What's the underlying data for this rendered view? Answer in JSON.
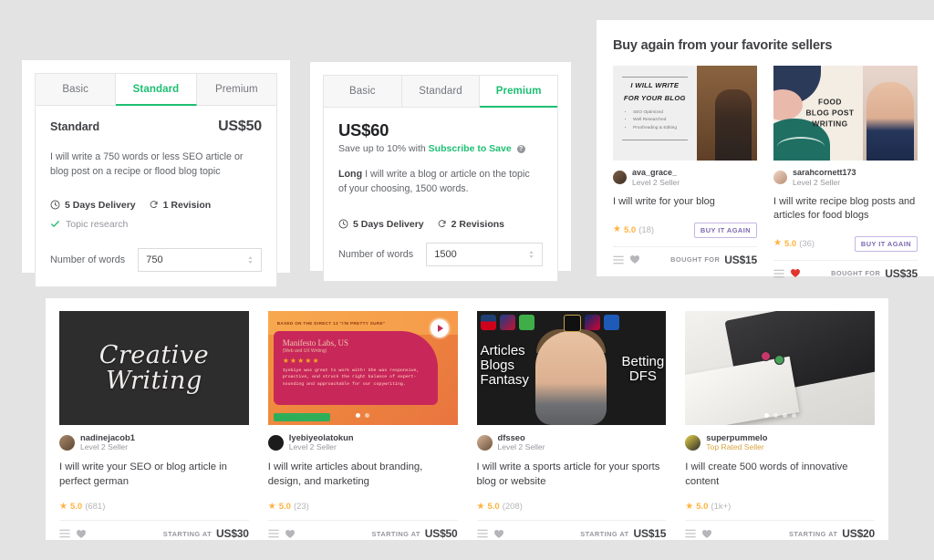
{
  "theme": {
    "page_bg": "#e3e3e3",
    "accent_green": "#1dbf73",
    "star_gold": "#ffb33e",
    "buy_again_purple": "#7b68b0",
    "text_dark": "#404145",
    "text_muted": "#95979d"
  },
  "pricing_standard": {
    "tabs": [
      {
        "label": "Basic",
        "active": false
      },
      {
        "label": "Standard",
        "active": true
      },
      {
        "label": "Premium",
        "active": false
      }
    ],
    "package_name": "Standard",
    "price": "US$50",
    "description": "I will write a 750 words or less SEO article or blog post on a recipe or flood blog topic",
    "delivery": "5 Days Delivery",
    "revisions": "1 Revision",
    "feature": "Topic research",
    "quantity_label": "Number of words",
    "quantity_value": "750"
  },
  "pricing_premium": {
    "tabs": [
      {
        "label": "Basic",
        "active": false
      },
      {
        "label": "Standard",
        "active": false
      },
      {
        "label": "Premium",
        "active": true
      }
    ],
    "price": "US$60",
    "save_prefix": "Save up to 10% with",
    "save_link": "Subscribe to Save",
    "info_glyph": "?",
    "description_bold": "Long",
    "description": " I will write a blog or article on the topic of your choosing, 1500 words.",
    "delivery": "5 Days Delivery",
    "revisions": "2 Revisions",
    "quantity_label": "Number of words",
    "quantity_value": "1500"
  },
  "buy_again": {
    "title": "Buy again from your favorite sellers",
    "cards": [
      {
        "art": "blog",
        "art_text": {
          "line1": "I WILL WRITE",
          "line2": "FOR YOUR BLOG",
          "bullets": [
            "SEO Optimized",
            "Well Researched",
            "Proofreading & Editing"
          ]
        },
        "seller": "ava_grace_",
        "level": "Level 2 Seller",
        "title": "I will write for your blog",
        "rating": "5.0",
        "reviews": "(18)",
        "button": "BUY IT AGAIN",
        "foot_label": "BOUGHT FOR",
        "price": "US$15",
        "favorited": false
      },
      {
        "art": "food",
        "art_text": {
          "line1": "FOOD",
          "line2": "BLOG POST",
          "line3": "WRITING"
        },
        "seller": "sarahcornett173",
        "level": "Level 2 Seller",
        "title": "I will write recipe blog posts and articles for food blogs",
        "rating": "5.0",
        "reviews": "(36)",
        "button": "BUY IT AGAIN",
        "foot_label": "BOUGHT FOR",
        "price": "US$35",
        "favorited": true
      }
    ]
  },
  "gig_row": {
    "cards": [
      {
        "art": "creative",
        "art_text": {
          "line1": "Creative",
          "line2": "Writing"
        },
        "seller": "nadinejacob1",
        "level": "Level 2 Seller",
        "level_style": "normal",
        "title": "I will write your SEO or blog article in perfect german",
        "rating": "5.0",
        "reviews": "(681)",
        "foot_label": "STARTING AT",
        "price": "US$30",
        "dots": 0,
        "active_dot": 0,
        "has_play": false
      },
      {
        "art": "video",
        "art_text": {
          "banner": "BASED ON THE DIRECT 13 \"I'M PRETTY SURE\"",
          "client": "Manifesto Labs, US",
          "client_sub": "(Web and UX Writing)",
          "stars": "★★★★★",
          "review": "Iyebiye was great to work with! She was responsive, proactive, and struck the right balance of expert-sounding and approachable for our copywriting."
        },
        "seller": "Iyebiyeolatokun",
        "level": "Level 2 Seller",
        "level_style": "normal",
        "title": "I will write articles about branding, design, and marketing",
        "rating": "5.0",
        "reviews": "(23)",
        "foot_label": "STARTING AT",
        "price": "US$50",
        "dots": 2,
        "active_dot": 0,
        "has_play": true
      },
      {
        "art": "sports",
        "art_text": {
          "left": "Articles\nBlogs\nFantasy",
          "right": "Betting\nDFS"
        },
        "seller": "dfsseo",
        "level": "Level 2 Seller",
        "level_style": "normal",
        "title": "I will write a sports article for your sports blog or website",
        "rating": "5.0",
        "reviews": "(208)",
        "foot_label": "STARTING AT",
        "price": "US$15",
        "dots": 0,
        "active_dot": 0,
        "has_play": false
      },
      {
        "art": "laptop",
        "art_text": {},
        "seller": "superpummelo",
        "level": "Top Rated Seller",
        "level_style": "top",
        "title": "I will create 500 words of innovative content",
        "rating": "5.0",
        "reviews": "(1k+)",
        "foot_label": "STARTING AT",
        "price": "US$20",
        "dots": 4,
        "active_dot": 0,
        "has_play": false
      }
    ]
  },
  "icons": {
    "clock": "clock-icon",
    "refresh": "refresh-icon",
    "check": "check-icon",
    "menu": "list-icon",
    "heart": "heart-icon",
    "star": "★",
    "spinner": "stepper-icon"
  }
}
